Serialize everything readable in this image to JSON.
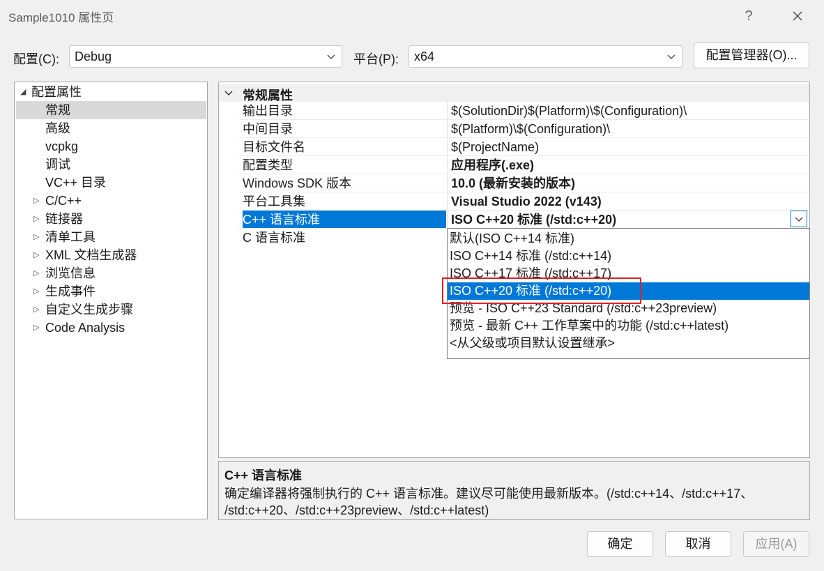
{
  "window": {
    "title": "Sample1010 属性页",
    "help_label": "?",
    "close_label": "✕"
  },
  "config_row": {
    "config_label": "配置(C):",
    "config_value": "Debug",
    "platform_label": "平台(P):",
    "platform_value": "x64",
    "manager_button": "配置管理器(O)..."
  },
  "tree": {
    "root": "配置属性",
    "items": [
      {
        "label": "常规",
        "selected": true,
        "expandable": false
      },
      {
        "label": "高级",
        "expandable": false
      },
      {
        "label": "vcpkg",
        "expandable": false
      },
      {
        "label": "调试",
        "expandable": false
      },
      {
        "label": "VC++ 目录",
        "expandable": false
      },
      {
        "label": "C/C++",
        "expandable": true
      },
      {
        "label": "链接器",
        "expandable": true
      },
      {
        "label": "清单工具",
        "expandable": true
      },
      {
        "label": "XML 文档生成器",
        "expandable": true
      },
      {
        "label": "浏览信息",
        "expandable": true
      },
      {
        "label": "生成事件",
        "expandable": true
      },
      {
        "label": "自定义生成步骤",
        "expandable": true
      },
      {
        "label": "Code Analysis",
        "expandable": true
      }
    ]
  },
  "grid": {
    "category": "常规属性",
    "properties": [
      {
        "name": "输出目录",
        "value": "$(SolutionDir)$(Platform)\\$(Configuration)\\",
        "bold": false
      },
      {
        "name": "中间目录",
        "value": "$(Platform)\\$(Configuration)\\",
        "bold": false
      },
      {
        "name": "目标文件名",
        "value": "$(ProjectName)",
        "bold": false
      },
      {
        "name": "配置类型",
        "value": "应用程序(.exe)",
        "bold": true
      },
      {
        "name": "Windows SDK 版本",
        "value": "10.0 (最新安装的版本)",
        "bold": true
      },
      {
        "name": "平台工具集",
        "value": "Visual Studio 2022 (v143)",
        "bold": true
      },
      {
        "name": "C++ 语言标准",
        "value": "ISO C++20 标准 (/std:c++20)",
        "bold": true,
        "selected": true
      },
      {
        "name": "C 语言标准",
        "value": "",
        "bold": false
      }
    ]
  },
  "dropdown": {
    "options": [
      "默认(ISO C++14 标准)",
      "ISO C++14 标准 (/std:c++14)",
      "ISO C++17 标准 (/std:c++17)",
      "ISO C++20 标准 (/std:c++20)",
      "预览 - ISO C++23 Standard (/std:c++23preview)",
      "预览 - 最新 C++ 工作草案中的功能 (/std:c++latest)",
      "<从父级或项目默认设置继承>"
    ],
    "selected_index": 3
  },
  "description": {
    "title": "C++ 语言标准",
    "line1": "确定编译器将强制执行的 C++ 语言标准。建议尽可能使用最新版本。(/std:c++14、/std:c++17、",
    "line2": "/std:c++20、/std:c++23preview、/std:c++latest)"
  },
  "footer": {
    "ok_label": "确定",
    "cancel_label": "取消",
    "apply_label": "应用(A)"
  },
  "colors": {
    "selection": "#0078d7",
    "highlight_box": "#e02020",
    "tree_selection": "#d9d9d9"
  }
}
